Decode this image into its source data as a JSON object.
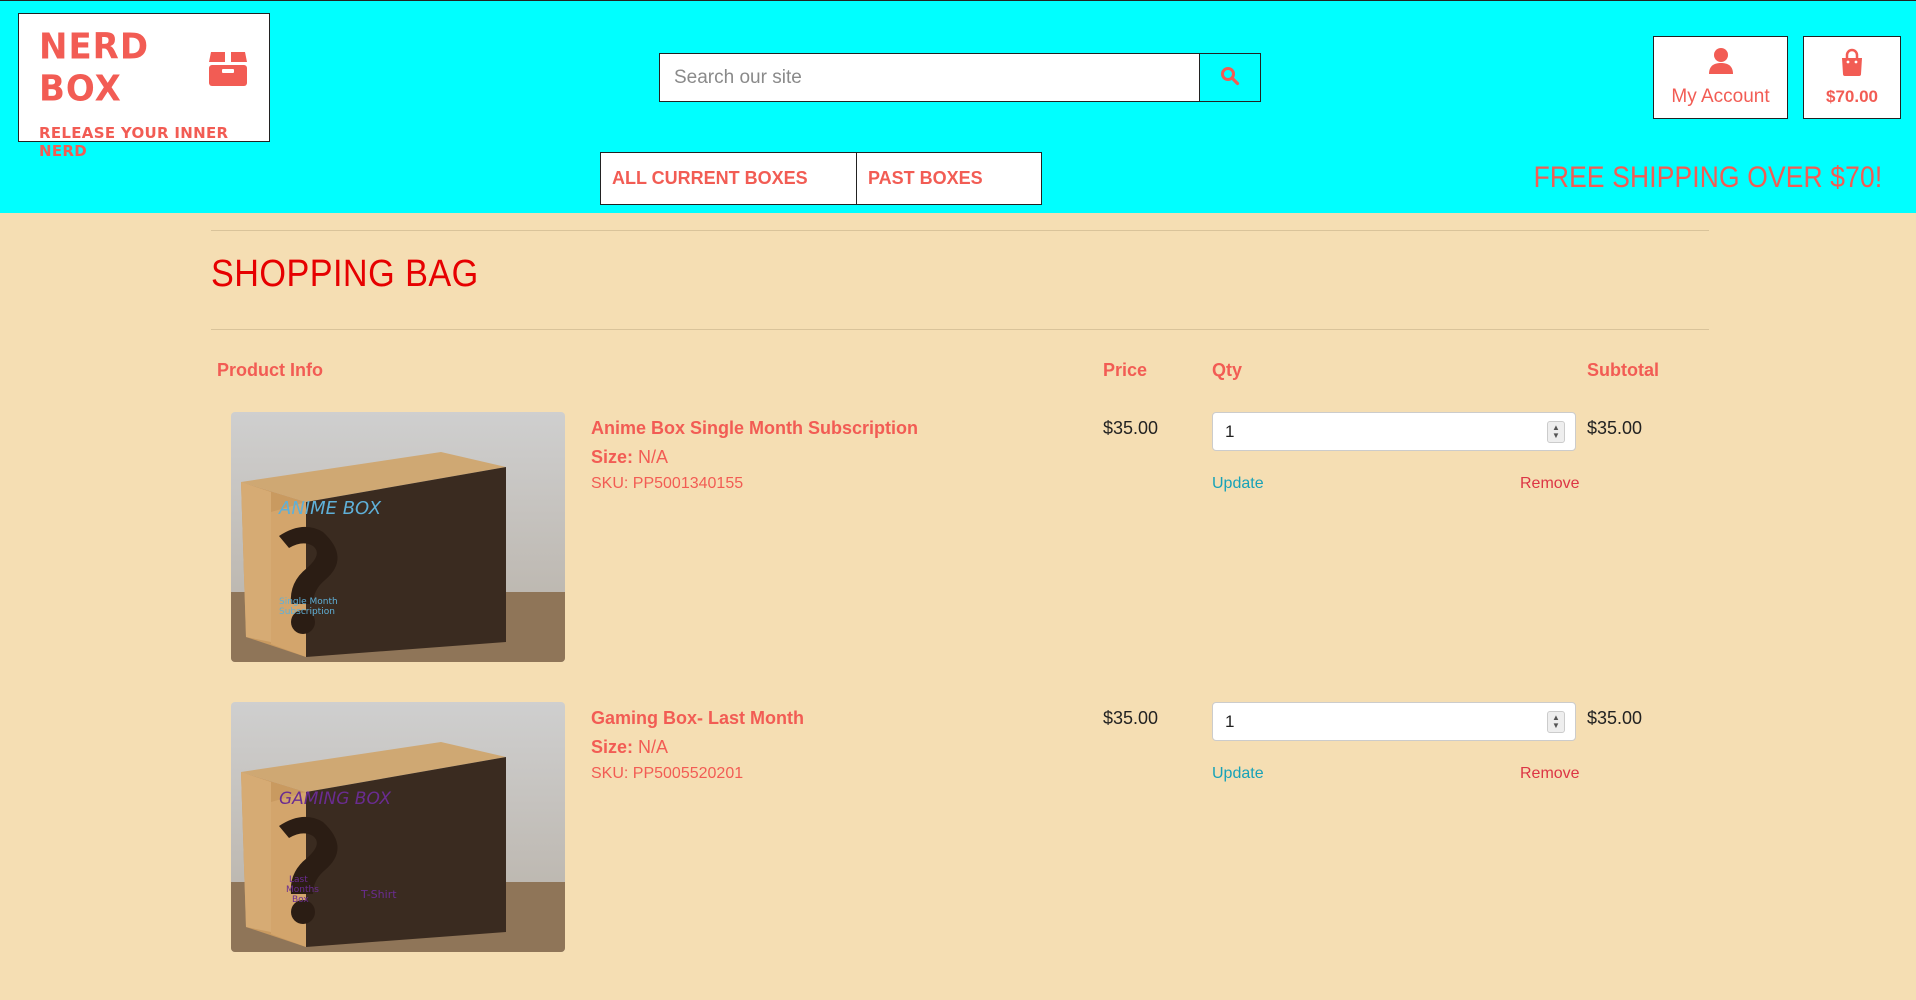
{
  "brand": {
    "name": "NERD BOX",
    "tagline": "RELEASE YOUR INNER NERD",
    "icon": "box-icon",
    "color": "#f25c54"
  },
  "search": {
    "placeholder": "Search our site",
    "value": "",
    "button_icon": "search-icon"
  },
  "account": {
    "label": "My Account",
    "icon": "user-icon"
  },
  "bag": {
    "total": "$70.00",
    "icon": "shopping-bag-icon"
  },
  "nav": {
    "items": [
      {
        "label": "ALL CURRENT BOXES"
      },
      {
        "label": "PAST BOXES"
      }
    ]
  },
  "promo": {
    "text": "FREE SHIPPING OVER $70!"
  },
  "page": {
    "title": "SHOPPING BAG"
  },
  "table": {
    "headers": {
      "product": "Product Info",
      "price": "Price",
      "qty": "Qty",
      "subtotal": "Subtotal"
    },
    "rows": [
      {
        "name": "Anime Box Single Month Subscription",
        "size_label": "Size:",
        "size": "N/A",
        "sku": "SKU: PP5001340155",
        "price": "$35.00",
        "qty": "1",
        "subtotal": "$35.00",
        "update": "Update",
        "remove": "Remove",
        "image": {
          "title": "ANIME BOX",
          "sub": [
            "Single Month",
            "Subscription"
          ],
          "title_color": "#5fb0d8"
        }
      },
      {
        "name": "Gaming Box- Last Month",
        "size_label": "Size:",
        "size": "N/A",
        "sku": "SKU: PP5005520201",
        "price": "$35.00",
        "qty": "1",
        "subtotal": "$35.00",
        "update": "Update",
        "remove": "Remove",
        "image": {
          "title": "GAMING BOX",
          "sub": [
            "Last",
            "Months",
            "Box"
          ],
          "extra": "T-Shirt",
          "title_color": "#6a2c91"
        }
      }
    ]
  },
  "colors": {
    "header_bg": "#00ffff",
    "page_bg": "#f5deb3",
    "accent": "#f25c54",
    "title": "#e60000",
    "update": "#17a2b8",
    "remove": "#dc3545"
  }
}
